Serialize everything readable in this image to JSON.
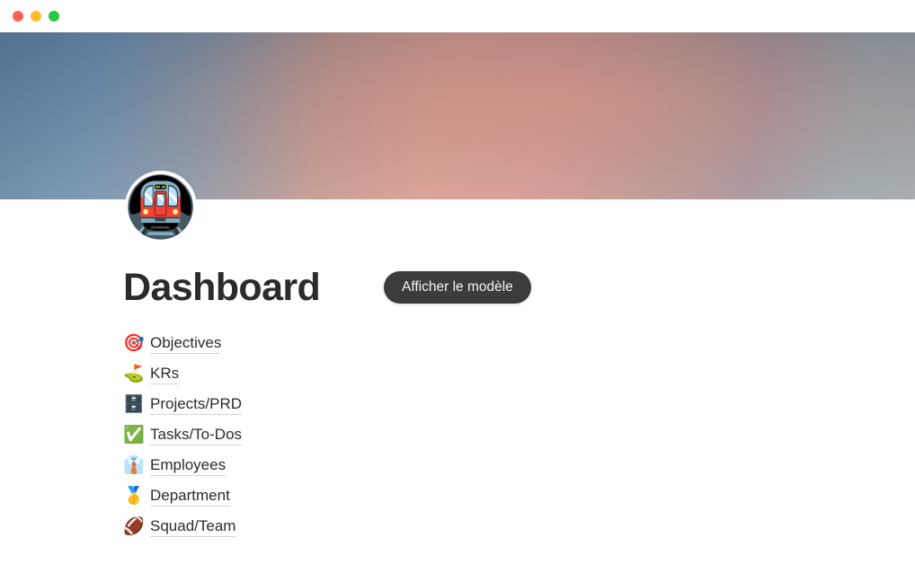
{
  "window": {
    "traffic_lights": [
      {
        "name": "close",
        "color": "#ff5f57"
      },
      {
        "name": "minimize",
        "color": "#febc2e"
      },
      {
        "name": "maximize",
        "color": "#28c840"
      }
    ]
  },
  "cover": {
    "gradient_colors": [
      "#5d7f9e",
      "#8f94a0",
      "#d79b8e",
      "#b9948e",
      "#9fa5a6"
    ]
  },
  "page": {
    "icon": "🚇",
    "icon_name": "metro-train-emoji",
    "title": "Dashboard"
  },
  "toolbar": {
    "template_button_label": "Afficher le modèle",
    "template_button_color": "#3d3c3b"
  },
  "links": [
    {
      "emoji": "🎯",
      "icon_name": "dart-target-icon",
      "label": "Objectives"
    },
    {
      "emoji": "⛳",
      "icon_name": "golf-flag-icon",
      "label": "KRs"
    },
    {
      "emoji": "🗄️",
      "icon_name": "file-cabinet-icon",
      "label": "Projects/PRD"
    },
    {
      "emoji": "✅",
      "icon_name": "check-mark-icon",
      "label": "Tasks/To-Dos"
    },
    {
      "emoji": "👔",
      "icon_name": "necktie-icon",
      "label": "Employees"
    },
    {
      "emoji": "🥇",
      "icon_name": "gold-medal-icon",
      "label": "Department"
    },
    {
      "emoji": "🏈",
      "icon_name": "football-icon",
      "label": "Squad/Team"
    }
  ]
}
